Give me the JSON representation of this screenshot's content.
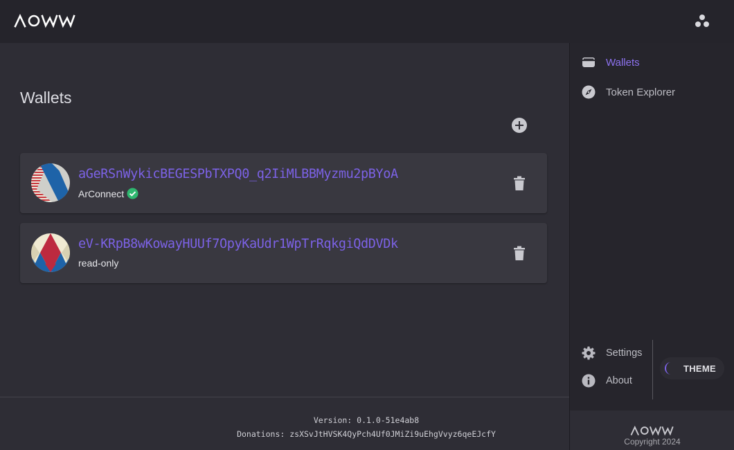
{
  "app": {
    "logo_text": "AOWW"
  },
  "header": {
    "account_icon": "account-dots-icon"
  },
  "main": {
    "title": "Wallets",
    "add_icon": "plus-circle-icon",
    "wallets": [
      {
        "address": "aGeRSnWykicBEGESPbTXPQ0_q2IiMLBBMyzmu2pBYoA",
        "type": "ArConnect",
        "verified": true,
        "verified_icon": "check-circle-icon",
        "delete_icon": "trash-icon"
      },
      {
        "address": "eV-KRpB8wKowayHUUf7OpyKaUdr1WpTrRqkgiQdDVDk",
        "type": "read-only",
        "verified": false,
        "delete_icon": "trash-icon"
      }
    ]
  },
  "footer": {
    "version": "Version: 0.1.0-51e4ab8",
    "donations": "Donations: zsXSvJtHVSK4QyPch4Uf0JMiZi9uEhgVvyz6qeEJcfY"
  },
  "sidebar": {
    "nav": [
      {
        "label": "Wallets",
        "icon": "wallet-icon",
        "active": true
      },
      {
        "label": "Token Explorer",
        "icon": "compass-icon",
        "active": false
      }
    ],
    "bottom": [
      {
        "label": "Settings",
        "icon": "gear-icon"
      },
      {
        "label": "About",
        "icon": "info-icon"
      }
    ],
    "theme_label": "THEME",
    "theme_icon": "moon-icon"
  },
  "sidebar_footer": {
    "logo_text": "AOWW",
    "copyright": "Copyright 2024"
  },
  "colors": {
    "accent": "#7c62e6",
    "active_nav": "#8d72f0",
    "success": "#2fb870",
    "background": "#2e2d35",
    "card": "#393840"
  }
}
